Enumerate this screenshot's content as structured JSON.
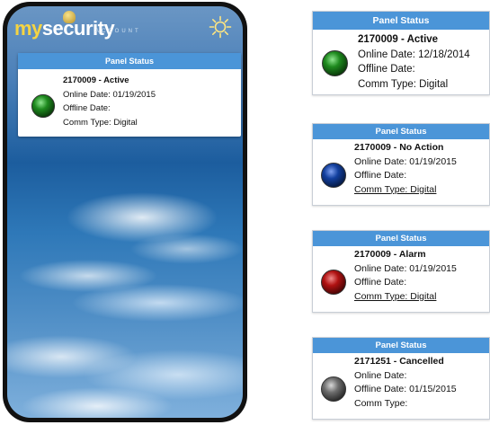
{
  "app": {
    "logo_my": "my",
    "logo_security": "security",
    "logo_tagline": "ACCOUNT",
    "settings_icon": "sun-icon"
  },
  "phone_panel": {
    "header": "Panel Status",
    "status_color": "#1e8a1e",
    "title": "2170009 - Active",
    "online": "Online Date: 01/19/2015",
    "offline": "Offline Date:",
    "comm": "Comm Type: Digital"
  },
  "cards": [
    {
      "header": "Panel Status",
      "status_color": "#1e8a1e",
      "title": "2170009 - Active",
      "online": "Online Date: 12/18/2014",
      "offline": "Offline Date:",
      "comm": "Comm Type: Digital"
    },
    {
      "header": "Panel Status",
      "status_color": "#123f9e",
      "title": "2170009 - No Action",
      "online": "Online Date: 01/19/2015",
      "offline": "Offline Date:",
      "comm": "Comm Type: Digital"
    },
    {
      "header": "Panel Status",
      "status_color": "#b01212",
      "title": "2170009 - Alarm",
      "online": "Online Date: 01/19/2015",
      "offline": "Offline Date:",
      "comm": "Comm Type: Digital"
    },
    {
      "header": "Panel Status",
      "status_color": "#6e6e6e",
      "title": "2171251 - Cancelled",
      "online": "Online Date:",
      "offline": "Offline Date: 01/15/2015",
      "comm": "Comm Type:"
    }
  ]
}
